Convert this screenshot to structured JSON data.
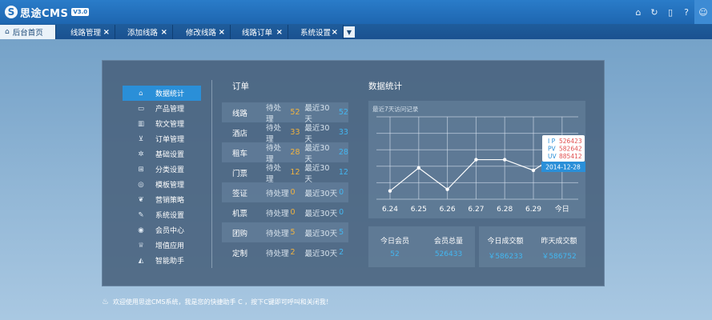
{
  "app": {
    "logo_mark": "S",
    "logo_text": "思途CMS",
    "version": "V3.0"
  },
  "top_icons": [
    "home-icon",
    "refresh-icon",
    "document-icon",
    "help-icon",
    "user-icon"
  ],
  "tabs": [
    {
      "label": "后台首页",
      "home": true
    },
    {
      "label": "线路管理"
    },
    {
      "label": "添加线路"
    },
    {
      "label": "修改线路"
    },
    {
      "label": "线路订单"
    },
    {
      "label": "系统设置"
    }
  ],
  "sidebar": {
    "items": [
      {
        "label": "数据统计",
        "icon": "home-icon",
        "active": true
      },
      {
        "label": "产品管理",
        "icon": "folder-icon"
      },
      {
        "label": "软文管理",
        "icon": "book-icon"
      },
      {
        "label": "订单管理",
        "icon": "cart-icon"
      },
      {
        "label": "基础设置",
        "icon": "gear-icon"
      },
      {
        "label": "分类设置",
        "icon": "grid-icon"
      },
      {
        "label": "模板管理",
        "icon": "compass-icon"
      },
      {
        "label": "营销策略",
        "icon": "leaf-icon"
      },
      {
        "label": "系统设置",
        "icon": "wrench-icon"
      },
      {
        "label": "会员中心",
        "icon": "location-icon"
      },
      {
        "label": "增值应用",
        "icon": "trophy-icon"
      },
      {
        "label": "智能助手",
        "icon": "assistant-icon"
      }
    ]
  },
  "orders": {
    "title": "订单",
    "pending_label": "待处理",
    "recent_label": "最近30天",
    "rows": [
      {
        "category": "线路",
        "pending": "52",
        "recent": "52"
      },
      {
        "category": "酒店",
        "pending": "33",
        "recent": "33"
      },
      {
        "category": "租车",
        "pending": "28",
        "recent": "28"
      },
      {
        "category": "门票",
        "pending": "12",
        "recent": "12"
      },
      {
        "category": "签证",
        "pending": "0",
        "recent": "0"
      },
      {
        "category": "机票",
        "pending": "0",
        "recent": "0"
      },
      {
        "category": "团购",
        "pending": "5",
        "recent": "5"
      },
      {
        "category": "定制",
        "pending": "2",
        "recent": "2"
      }
    ]
  },
  "stats": {
    "title": "数据统计",
    "chart_subtitle": "最近7天访问记录",
    "tooltip": {
      "ip_label": "I P",
      "ip_value": "526423",
      "pv_label": "PV",
      "pv_value": "582642",
      "uv_label": "UV",
      "uv_value": "885412",
      "date": "2014-12-28"
    }
  },
  "chart_data": {
    "type": "line",
    "title": "最近7天访问记录",
    "categories": [
      "6.24",
      "6.25",
      "6.26",
      "6.27",
      "6.28",
      "6.29",
      "今日"
    ],
    "values": [
      10,
      38,
      12,
      48,
      48,
      35,
      58
    ],
    "ylim": [
      0,
      100
    ],
    "grid": true,
    "line_color": "#ffffff"
  },
  "summary": {
    "today_members_label": "今日会员",
    "today_members_value": "52",
    "total_members_label": "会员总量",
    "total_members_value": "526433",
    "today_deals_label": "今日成交额",
    "today_deals_value": "￥586233",
    "yesterday_deals_label": "昨天成交额",
    "yesterday_deals_value": "￥586752"
  },
  "footer": {
    "message": "欢迎使用思途CMS系统，我是您的快捷助手 C ，按下C键即可呼叫和关闭我！"
  },
  "colors": {
    "accent": "#2a8fd8",
    "pending": "#f0b340",
    "recent": "#43b6f0",
    "tooltip_text": "#e05050"
  }
}
